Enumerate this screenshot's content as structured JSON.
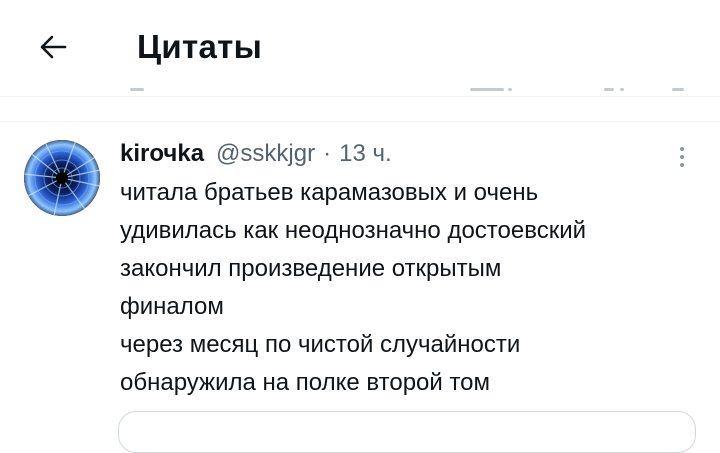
{
  "header": {
    "title": "Цитаты",
    "back_icon": "arrow-left-icon"
  },
  "tweet": {
    "author_name": "kirочka",
    "handle": "@sskkjgr",
    "separator": "·",
    "time": "13 ч.",
    "text_lines": [
      "читала братьев карамазовых и очень",
      "удивилась как неоднозначно достоевский",
      "закончил произведение открытым",
      "финалом",
      "через месяц по чистой случайности",
      "обнаружила на полке второй том"
    ],
    "more_icon": "more-vertical-icon",
    "avatar_icon": "blue-tunnel-avatar"
  },
  "colors": {
    "text": "#0f1419",
    "secondary": "#536471",
    "border": "#cfd9de"
  }
}
